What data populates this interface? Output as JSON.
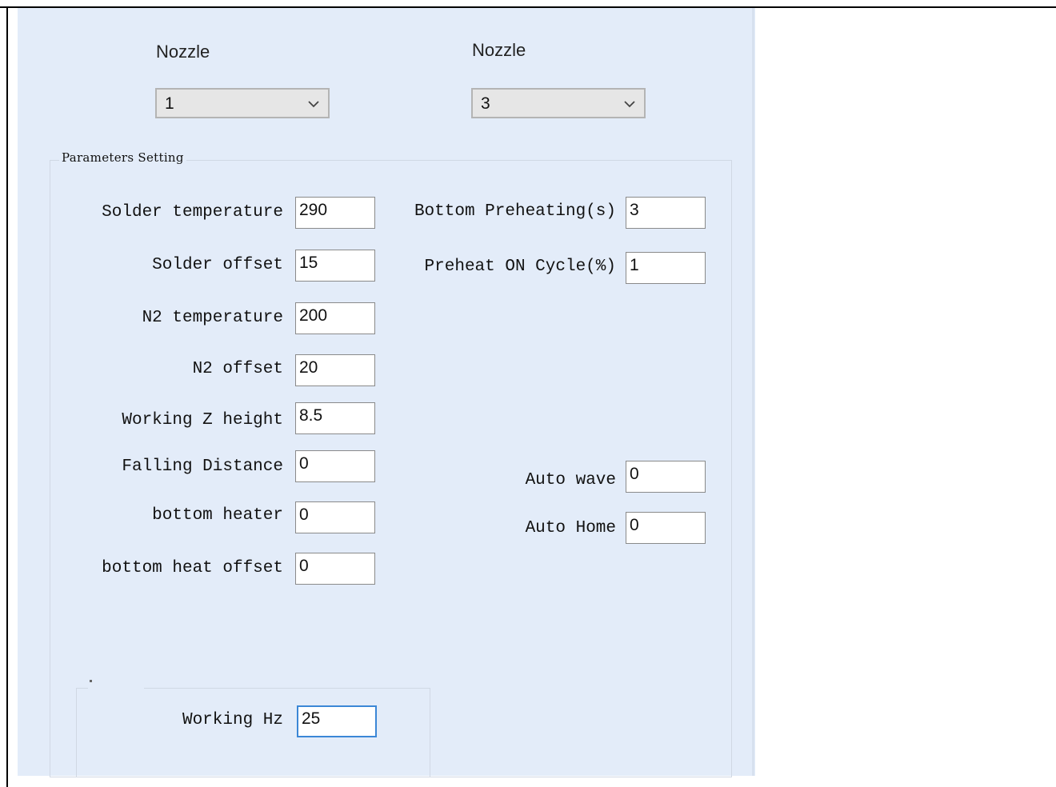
{
  "nozzles": [
    {
      "label": "Nozzle",
      "value": "1"
    },
    {
      "label": "Nozzle",
      "value": "3"
    }
  ],
  "params": {
    "title": "Parameters Setting",
    "left": [
      {
        "label": "Solder temperature",
        "value": "290"
      },
      {
        "label": "Solder offset",
        "value": "15"
      },
      {
        "label": "N2 temperature",
        "value": "200"
      },
      {
        "label": "N2 offset",
        "value": "20"
      },
      {
        "label": "Working Z height",
        "value": "8.5"
      },
      {
        "label": "Falling Distance",
        "value": "0"
      },
      {
        "label": "bottom heater",
        "value": "0"
      },
      {
        "label": "bottom heat offset",
        "value": "0"
      }
    ],
    "right": [
      {
        "label": "Bottom Preheating(s)",
        "value": "3"
      },
      {
        "label": "Preheat ON Cycle(%)",
        "value": "1"
      },
      {
        "label": "Auto wave",
        "value": "0"
      },
      {
        "label": "Auto Home",
        "value": "0"
      }
    ]
  },
  "working_hz": {
    "label": "Working Hz",
    "value": "25"
  }
}
